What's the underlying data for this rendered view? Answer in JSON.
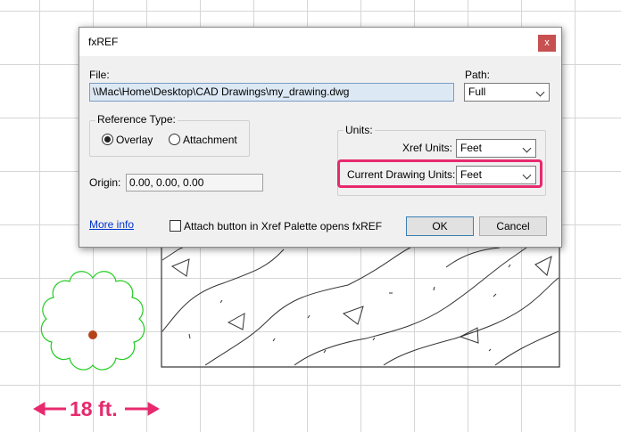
{
  "dialog": {
    "title": "fxREF",
    "close_glyph": "x",
    "file_label": "File:",
    "file_value": "\\\\Mac\\Home\\Desktop\\CAD Drawings\\my_drawing.dwg",
    "path_label": "Path:",
    "path_value": "Full",
    "reference_type": {
      "label": "Reference Type:",
      "options": [
        "Overlay",
        "Attachment"
      ],
      "selected": "Overlay"
    },
    "units": {
      "label": "Units:",
      "xref_units_label": "Xref Units:",
      "xref_units_value": "Feet",
      "current_units_label": "Current Drawing Units:",
      "current_units_value": "Feet"
    },
    "origin_label": "Origin:",
    "origin_value": "0.00, 0.00, 0.00",
    "more_info": "More info",
    "attach_checkbox_label": "Attach button in Xref Palette opens fxREF",
    "attach_checked": false,
    "ok": "OK",
    "cancel": "Cancel"
  },
  "annotation": {
    "dimension_label": "18 ft.",
    "highlight_color": "#e8296e"
  },
  "colors": {
    "tree_outline": "#22cc22",
    "tree_center": "#b5431a",
    "drawing_lines": "#333333"
  }
}
